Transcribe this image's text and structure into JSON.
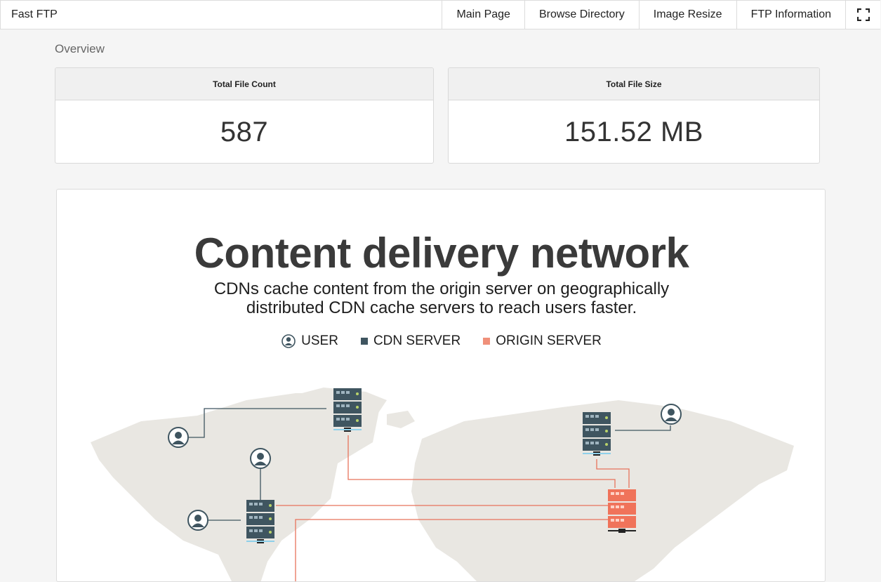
{
  "app": {
    "title": "Fast FTP"
  },
  "nav": {
    "items": [
      {
        "label": "Main Page"
      },
      {
        "label": "Browse Directory"
      },
      {
        "label": "Image Resize"
      },
      {
        "label": "FTP Information"
      }
    ],
    "fullscreen_icon": "fullscreen-icon"
  },
  "overview": {
    "title": "Overview",
    "cards": [
      {
        "label": "Total File Count",
        "value": "587"
      },
      {
        "label": "Total File Size",
        "value": "151.52 MB"
      }
    ]
  },
  "infographic": {
    "title": "Content delivery network",
    "subtitle_line1": "CDNs cache content from the origin server on geographically",
    "subtitle_line2": "distributed CDN cache servers to reach users faster.",
    "legend": [
      {
        "label": "USER",
        "icon": "user-icon"
      },
      {
        "label": "CDN SERVER",
        "color": "#3f5560"
      },
      {
        "label": "ORIGIN SERVER",
        "color": "#f0907a"
      }
    ],
    "colors": {
      "cdn_server": "#3f5560",
      "origin_server": "#f0735a",
      "map_land": "#e9e7e2",
      "link_line": "#e8735c"
    }
  }
}
